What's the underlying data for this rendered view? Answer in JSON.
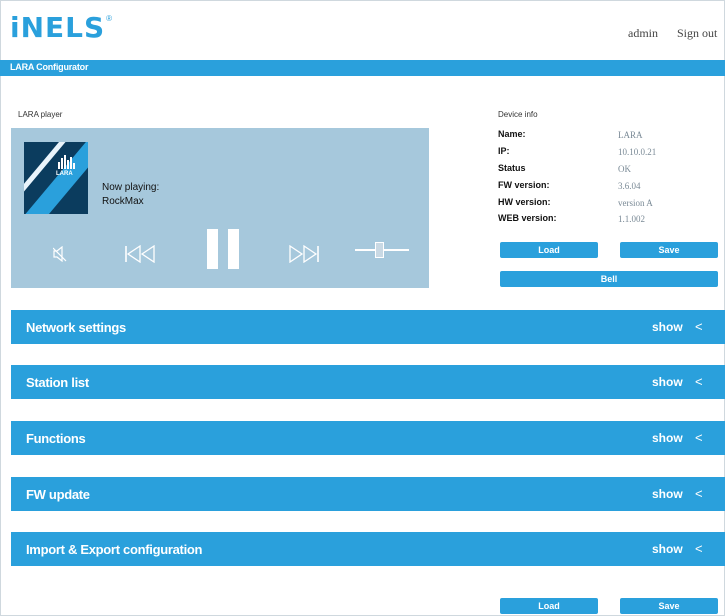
{
  "header": {
    "logo_text": "iNELS",
    "logo_mark": "®",
    "admin_link": "admin",
    "signout_link": "Sign out"
  },
  "title_bar": {
    "title": "LARA Configurator"
  },
  "player": {
    "label": "LARA player",
    "cover_text": "LARA",
    "now_playing_label": "Now playing:",
    "station": "RockMax",
    "volume_level": 0.45
  },
  "device_info": {
    "label": "Device info",
    "rows": [
      {
        "key": "Name:",
        "value": "LARA"
      },
      {
        "key": "IP:",
        "value": "10.10.0.21"
      },
      {
        "key": "Status",
        "value": "OK"
      },
      {
        "key": "FW version:",
        "value": "3.6.04"
      },
      {
        "key": "HW version:",
        "value": "version A"
      },
      {
        "key": "WEB version:",
        "value": "1.1.002"
      }
    ],
    "load_button": "Load",
    "save_button": "Save",
    "bell_button": "Bell"
  },
  "sections": [
    {
      "title": "Network settings",
      "toggle": "show",
      "chevron": "<"
    },
    {
      "title": "Station list",
      "toggle": "show",
      "chevron": "<"
    },
    {
      "title": "Functions",
      "toggle": "show",
      "chevron": "<"
    },
    {
      "title": "FW update",
      "toggle": "show",
      "chevron": "<"
    },
    {
      "title": "Import & Export configuration",
      "toggle": "show",
      "chevron": "<"
    }
  ],
  "footer": {
    "load_button": "Load",
    "save_button": "Save"
  },
  "colors": {
    "accent": "#2aa0dc",
    "player_bg": "#a6c8dc",
    "value_text": "#7a8a96"
  }
}
